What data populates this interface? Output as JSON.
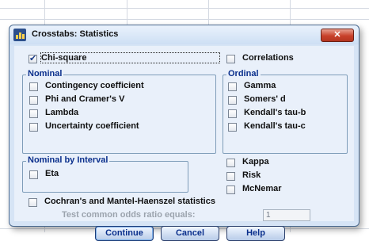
{
  "dialog": {
    "title": "Crosstabs: Statistics",
    "close_label": "✕"
  },
  "options": {
    "chi_square": {
      "label": "Chi-square",
      "checked": true
    },
    "correlations": {
      "label": "Correlations",
      "checked": false
    }
  },
  "nominal": {
    "title": "Nominal",
    "items": [
      {
        "label": "Contingency coefficient",
        "checked": false
      },
      {
        "label": "Phi and Cramer's V",
        "checked": false
      },
      {
        "label": "Lambda",
        "checked": false
      },
      {
        "label": "Uncertainty coefficient",
        "checked": false
      }
    ]
  },
  "ordinal": {
    "title": "Ordinal",
    "items": [
      {
        "label": "Gamma",
        "checked": false
      },
      {
        "label": "Somers' d",
        "checked": false
      },
      {
        "label": "Kendall's tau-b",
        "checked": false
      },
      {
        "label": "Kendall's tau-c",
        "checked": false
      }
    ]
  },
  "nominal_by_interval": {
    "title": "Nominal by Interval",
    "items": [
      {
        "label": "Eta",
        "checked": false
      }
    ]
  },
  "other": {
    "items": [
      {
        "label": "Kappa",
        "checked": false
      },
      {
        "label": "Risk",
        "checked": false
      },
      {
        "label": "McNemar",
        "checked": false
      }
    ]
  },
  "cochran": {
    "label": "Cochran's and Mantel-Haenszel statistics",
    "checked": false,
    "odds_label": "Test common odds ratio equals:",
    "odds_value": "1"
  },
  "buttons": {
    "continue": "Continue",
    "cancel": "Cancel",
    "help": "Help"
  }
}
